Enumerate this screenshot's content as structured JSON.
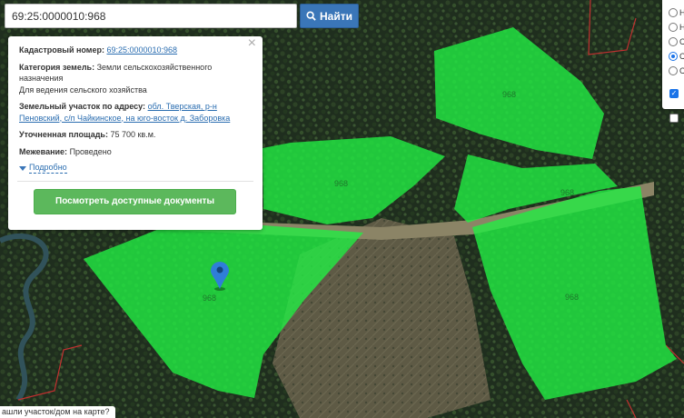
{
  "search": {
    "value": "69:25:0000010:968",
    "button_label": "Найти"
  },
  "popup": {
    "cadastral_label": "Кадастровый номер:",
    "cadastral_value": "69:25:0000010:968",
    "category_label": "Категория земель:",
    "category_value": "Земли сельскохозяйственного назначения",
    "category_usage": "Для ведения сельского хозяйства",
    "address_label": "Земельный участок по адресу:",
    "address_value": "обл. Тверская, р-н Пеновский, с/п Чайкинское, на юго-восток д. Заборовка",
    "area_label": "Уточненная площадь:",
    "area_value": "75 700 кв.м.",
    "survey_label": "Межевание:",
    "survey_value": "Проведено",
    "more_label": "Подробно",
    "docs_button": "Посмотреть доступные документы"
  },
  "map": {
    "parcel_label": "968",
    "parcel_color": "#22ee44"
  },
  "layers": {
    "options": [
      "Н",
      "Н",
      "С",
      "С",
      "С"
    ],
    "selected_index": 3
  },
  "bottom_tip": "ашли участок/дом на карте?"
}
